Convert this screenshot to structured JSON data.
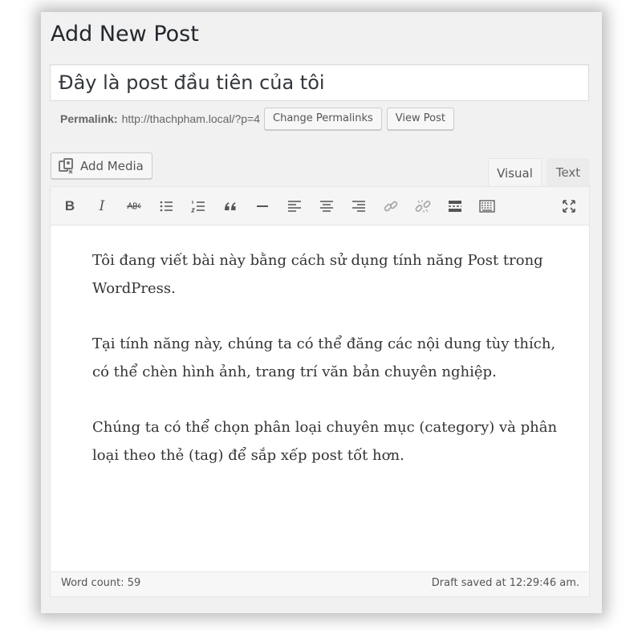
{
  "page": {
    "title": "Add New Post"
  },
  "post": {
    "title": "Đây là post đầu tiên của tôi",
    "permalink_label": "Permalink:",
    "permalink_url": "http://thachpham.local/?p=4"
  },
  "buttons": {
    "change_permalinks": "Change Permalinks",
    "view_post": "View Post",
    "add_media": "Add Media"
  },
  "tabs": {
    "visual": "Visual",
    "text": "Text",
    "active": "Visual"
  },
  "toolbar": {
    "buttons": [
      "bold-icon",
      "italic-icon",
      "strikethrough-icon",
      "bulleted-list-icon",
      "numbered-list-icon",
      "blockquote-icon",
      "horizontal-line-icon",
      "align-left-icon",
      "align-center-icon",
      "align-right-icon",
      "link-icon",
      "unlink-icon",
      "read-more-icon",
      "toolbar-toggle-icon",
      "fullscreen-icon"
    ],
    "bold_glyph": "B",
    "italic_glyph": "I"
  },
  "content": {
    "paragraphs": [
      "Tôi đang viết bài này bằng cách sử dụng tính năng Post trong WordPress.",
      "Tại tính năng này, chúng ta có thể đăng các nội dung tùy thích, có thể chèn hình ảnh, trang trí văn bản chuyên nghiệp.",
      "Chúng ta có thể chọn phân loại chuyên mục (category) và phân loại theo thẻ (tag) để sắp xếp post tốt hơn."
    ]
  },
  "status": {
    "word_count": "Word count: 59",
    "draft_saved": "Draft saved at 12:29:46 am."
  }
}
